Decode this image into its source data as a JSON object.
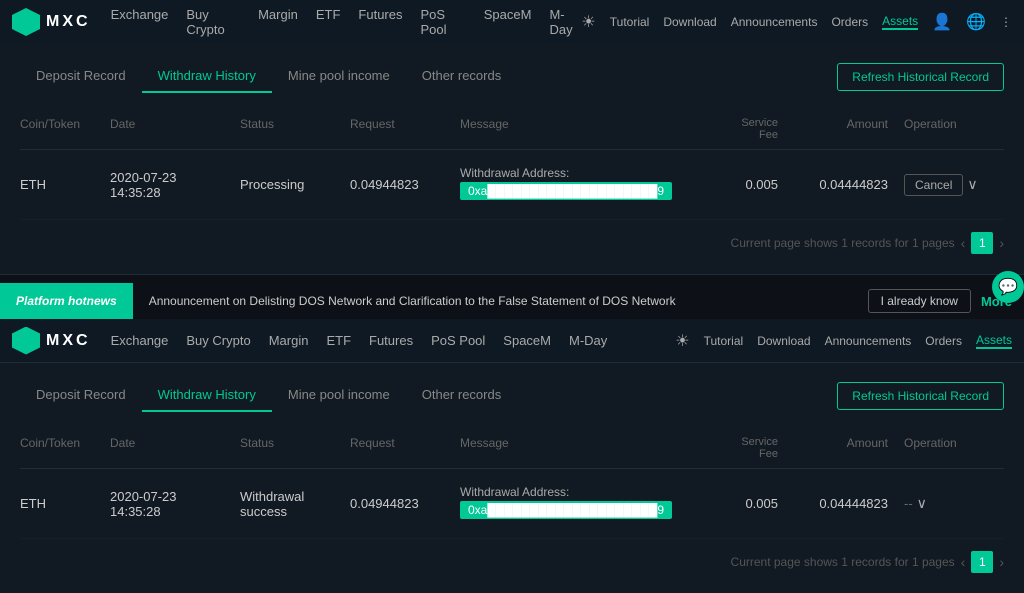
{
  "top": {
    "logo": "MXC",
    "nav": [
      {
        "label": "Exchange",
        "active": false
      },
      {
        "label": "Buy Crypto",
        "active": false
      },
      {
        "label": "Margin",
        "active": false
      },
      {
        "label": "ETF",
        "active": false
      },
      {
        "label": "Futures",
        "active": false
      },
      {
        "label": "PoS Pool",
        "active": false
      },
      {
        "label": "SpaceM",
        "active": false
      },
      {
        "label": "M-Day",
        "active": false
      }
    ],
    "right": [
      {
        "label": "Tutorial"
      },
      {
        "label": "Download"
      },
      {
        "label": "Announcements"
      },
      {
        "label": "Orders"
      },
      {
        "label": "Assets",
        "active": true
      }
    ]
  },
  "panel1": {
    "tabs": [
      {
        "label": "Deposit Record",
        "active": false
      },
      {
        "label": "Withdraw History",
        "active": true
      },
      {
        "label": "Mine pool income",
        "active": false
      },
      {
        "label": "Other records",
        "active": false
      }
    ],
    "refresh_btn": "Refresh Historical Record",
    "table": {
      "headers": [
        "Coin/Token",
        "Date",
        "Status",
        "Request",
        "Message",
        "Service Fee",
        "Amount",
        "Operation"
      ],
      "rows": [
        {
          "coin": "ETH",
          "date": "2020-07-23",
          "time": "14:35:28",
          "status": "Processing",
          "request": "0.04944823",
          "msg_label": "Withdrawal Address:",
          "msg_prefix": "0xa",
          "msg_suffix": "9",
          "service_fee": "0.005",
          "amount": "0.04444823",
          "operation": "Cancel"
        }
      ]
    },
    "pagination": {
      "text": "Current page shows 1 records for 1 pages",
      "current_page": "1"
    }
  },
  "banner": {
    "label": "Platform hotnews",
    "text": "Announcement on Delisting DOS Network and Clarification to the False Statement of DOS Network",
    "know_btn": "I already know",
    "more_btn": "More"
  },
  "panel2": {
    "tabs": [
      {
        "label": "Deposit Record",
        "active": false
      },
      {
        "label": "Withdraw History",
        "active": true
      },
      {
        "label": "Mine pool income",
        "active": false
      },
      {
        "label": "Other records",
        "active": false
      }
    ],
    "refresh_btn": "Refresh Historical Record",
    "table": {
      "headers": [
        "Coin/Token",
        "Date",
        "Status",
        "Request",
        "Message",
        "Service Fee",
        "Amount",
        "Operation"
      ],
      "rows": [
        {
          "coin": "ETH",
          "date": "2020-07-23",
          "time": "14:35:28",
          "status_line1": "Withdrawal",
          "status_line2": "success",
          "request": "0.04944823",
          "msg_label": "Withdrawal Address:",
          "msg_prefix": "0xa",
          "msg_suffix": "9",
          "service_fee": "0.005",
          "amount": "0.04444823",
          "operation": "--"
        }
      ]
    },
    "pagination": {
      "text": "Current page shows 1 records for 1 pages",
      "current_page": "1"
    }
  }
}
